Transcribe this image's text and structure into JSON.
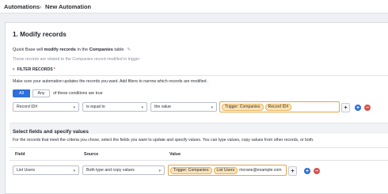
{
  "breadcrumb": {
    "root": "Automations",
    "separator": "›",
    "current": "New Automation"
  },
  "step": {
    "title": "1. Modify records",
    "desc_prefix": "Quick Base will ",
    "desc_bold": "modify records",
    "desc_mid": " in the ",
    "desc_table": "Companies",
    "desc_suffix": " table",
    "subtext": "These records are related to the Companies record modified in trigger"
  },
  "filter": {
    "label": "FILTER RECORDS",
    "required_mark": "*",
    "hint": "Make sure your automation updates the records you want. Add filters to narrow which records are modified .",
    "toggle": {
      "all": "All",
      "any": "Any",
      "selected": "All"
    },
    "conditions_text": "of these conditions are true",
    "row": {
      "field": "Record ID#",
      "operator": "is equal to",
      "value_type": "the value",
      "value_pills": [
        "Trigger: Companies",
        "Record ID#"
      ]
    }
  },
  "fields_section": {
    "title": "Select fields and specify values",
    "desc": "For the records that meet the criteria you chose, select the fields you want to update and specify values. You can type values, copy values from other records, or both.",
    "columns": [
      "Field",
      "Source",
      "Value"
    ],
    "row": {
      "field": "List Users",
      "source": "Both type and copy values",
      "value_pills": [
        "Trigger: Companies",
        "List Users"
      ],
      "value_text": "mcrane@example.com"
    }
  },
  "icons": {
    "insert": "+",
    "add": "+",
    "remove": "−",
    "dropdown": "▾",
    "expand": "▿",
    "edit": "✎"
  },
  "colors": {
    "accent": "#2e6fd8",
    "pill_bg": "#fbe3b6",
    "pill_border": "#e8b35a",
    "remove": "#d9534f"
  }
}
